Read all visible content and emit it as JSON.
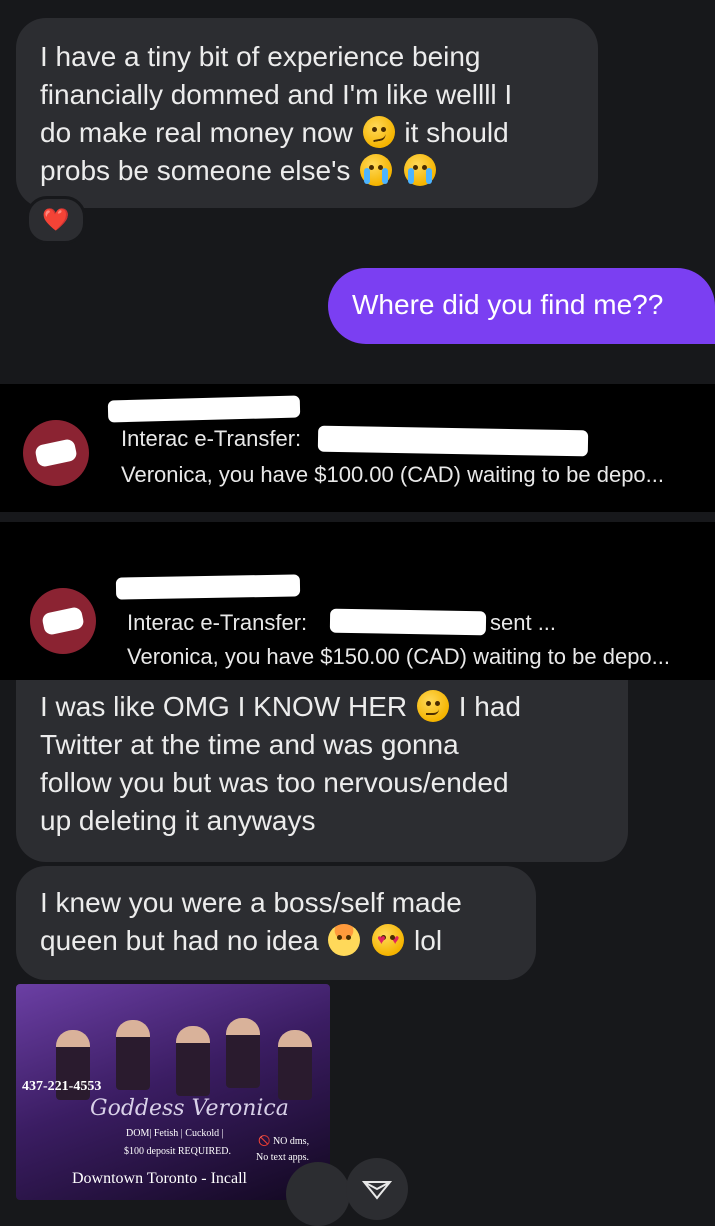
{
  "messages": {
    "m1_lines": [
      "I have a tiny bit of experience being",
      "financially dommed and I'm like wellll I",
      "do make real money now",
      "it should",
      "probs be someone else's"
    ],
    "reaction": "❤️",
    "m2": "Where did you find me??",
    "m3_lines": [
      "I was like OMG I KNOW HER",
      "I had",
      "Twitter at the time and was gonna",
      "follow you but was too nervous/ended",
      "up deleting it anyways"
    ],
    "m4_lines": [
      "I knew you were a boss/self made",
      "queen but had no idea",
      "lol"
    ]
  },
  "notifications": [
    {
      "app": "Interac e-Transfer:",
      "suffix": "",
      "body": "Veronica, you have $100.00 (CAD) waiting to be depo..."
    },
    {
      "app": "Interac e-Transfer:",
      "suffix": "sent ...",
      "body": "Veronica, you have $150.00 (CAD) waiting to be depo..."
    }
  ],
  "promo": {
    "phone": "437-221-4553",
    "name": "Goddess Veronica",
    "tags": "DOM| Fetish | Cuckold |",
    "deposit": "$100 deposit REQUIRED.",
    "no_dms": "🚫 NO dms,",
    "no_text_apps": "No text apps.",
    "location": "Downtown Toronto - Incall"
  },
  "icons": [
    "smirk-emoji",
    "sob-emoji",
    "relieved-emoji",
    "exploding-head-emoji",
    "heart-eyes-emoji",
    "heart-reaction",
    "interac-icon",
    "send-icon"
  ],
  "colors": {
    "outgoing_bubble": "#7b3ff2",
    "incoming_bubble": "#2c2d31",
    "background": "#17181b",
    "interac": "#8b2332"
  }
}
